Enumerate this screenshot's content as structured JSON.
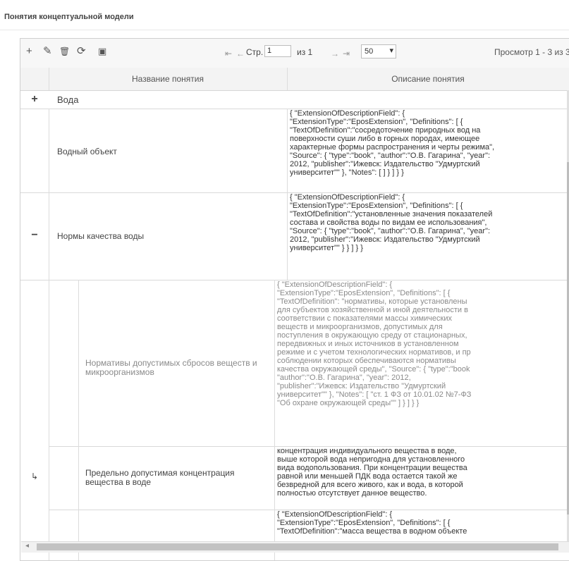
{
  "panel": {
    "title": "Понятия концептуальной модели"
  },
  "toolbar": {
    "add_icon": "+",
    "edit_icon": "✎",
    "delete_icon": "🗑",
    "refresh_icon": "⟳",
    "view_icon": "▣",
    "first_page": "⇤",
    "prev_page": "←",
    "page_label": "Стр.",
    "page_value": "1",
    "of_label": "из 1",
    "next_page": "→",
    "last_page": "⇥",
    "page_size": "50",
    "view_info": "Просмотр 1 - 3 из 3"
  },
  "table": {
    "headers": {
      "name": "Название понятия",
      "description": "Описание понятия"
    },
    "rows": [
      {
        "icon": "+",
        "name": "Вода",
        "description": ""
      },
      {
        "icon": "",
        "name": "Водный объект",
        "description": "{ \"ExtensionOfDescriptionField\": {\n\"ExtensionType\":\"EposExtension\", \"Definitions\": [ {\n\"TextOfDefinition\":\"сосредоточение природных вод на\nповерхности суши либо в горных породах, имеющее\nхарактерные формы распространения и черты режима\",\n\"Source\": { \"type\":\"book\", \"author\":\"О.В. Гагарина\", \"year\":\n2012, \"publisher\":\"Ижевск: Издательство \"Удмуртский\nуниверситет\"\" }, \"Notes\": [ ] } ] } }"
      },
      {
        "icon": "−",
        "name": "Нормы качества воды",
        "description": "{ \"ExtensionOfDescriptionField\": {\n\"ExtensionType\":\"EposExtension\", \"Definitions\": [ {\n\"TextOfDefinition\":\"установленные значения показателей\nсостава и свойства воды по видам ее использования\",\n\"Source\": { \"type\":\"book\", \"author\":\"О.В. Гагарина\", \"year\":\n2012, \"publisher\":\"Ижевск: Издательство \"Удмуртский\nуниверситет\"\" } } ] } }"
      },
      {
        "icon": "",
        "name": "Нормативы допустимых сбросов веществ и\nмикроорганизмов",
        "description": "{ \"ExtensionOfDescriptionField\": {\n\"ExtensionType\":\"EposExtension\", \"Definitions\": [ {\n\"TextOfDefinition\": \"нормативы, которые установлены\nдля субъектов хозяйственной и иной деятельности в\nсоответствии с показателями массы химических\nвеществ и микроорганизмов, допустимых для\nпоступления в окружающую среду от стационарных,\nпередвижных и иных источников в установленном\nрежиме и с учетом технологических нормативов, и пр\nсоблюдении которых обеспечиваются нормативы\nкачества окружающей среды\", \"Source\": { \"type\":\"book\n\"author\":\"О.В. Гагарина\", \"year\": 2012,\n\"publisher\":\"Ижевск: Издательство \"Удмуртский\nуниверситет\"\" }, \"Notes\": [ \"ст. 1 ФЗ от 10.01.02 №7-ФЗ\n\"Об охране окружающей среды\"\" ] } ] } }"
      },
      {
        "icon": "↳",
        "name": "Предельно допустимая концентрация\nвещества в воде",
        "description": "концентрация индивидуального вещества в воде,\nвыше которой вода непригодна для установленного\nвида водопользования. При концентрации вещества\nравной или меньшей ПДК вода остается такой же\nбезвредной для всего живого, как и вода, в которой\nполностью отсутствует данное вещество."
      },
      {
        "icon": "",
        "name": "",
        "description": "{ \"ExtensionOfDescriptionField\": {\n\"ExtensionType\":\"EposExtension\", \"Definitions\": [ {\n\"TextOfDefinition\":\"масса вещества в водном объекте"
      }
    ]
  },
  "colors": {
    "header_bg": "#f3f3f3",
    "border": "#d6d6d6",
    "text": "#333333",
    "sub_text": "#8a8a8a"
  }
}
